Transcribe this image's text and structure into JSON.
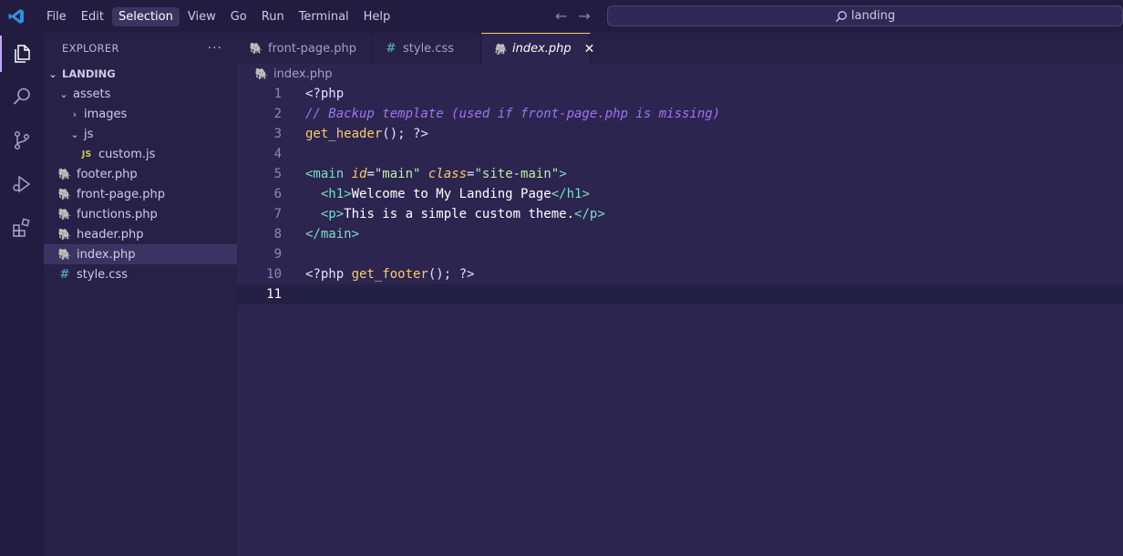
{
  "titlebar": {
    "menu": [
      "File",
      "Edit",
      "Selection",
      "View",
      "Go",
      "Run",
      "Terminal",
      "Help"
    ],
    "active_menu_index": 2,
    "search_text": "landing"
  },
  "sidebar": {
    "title": "EXPLORER",
    "more": "···",
    "root": "LANDING",
    "tree": [
      {
        "label": "assets",
        "depth": 1,
        "kind": "folder",
        "open": true
      },
      {
        "label": "images",
        "depth": 2,
        "kind": "folder",
        "open": false
      },
      {
        "label": "js",
        "depth": 2,
        "kind": "folder",
        "open": true
      },
      {
        "label": "custom.js",
        "depth": 3,
        "kind": "js"
      },
      {
        "label": "footer.php",
        "depth": 1,
        "kind": "php"
      },
      {
        "label": "front-page.php",
        "depth": 1,
        "kind": "php"
      },
      {
        "label": "functions.php",
        "depth": 1,
        "kind": "php"
      },
      {
        "label": "header.php",
        "depth": 1,
        "kind": "php"
      },
      {
        "label": "index.php",
        "depth": 1,
        "kind": "php",
        "selected": true
      },
      {
        "label": "style.css",
        "depth": 1,
        "kind": "css"
      }
    ]
  },
  "tabs": [
    {
      "label": "front-page.php",
      "kind": "php",
      "active": false
    },
    {
      "label": "style.css",
      "kind": "css",
      "active": false
    },
    {
      "label": "index.php",
      "kind": "php",
      "active": true
    }
  ],
  "breadcrumb": "index.php",
  "editor": {
    "current_line": 11,
    "lines": [
      [
        [
          "plain",
          "<?php"
        ]
      ],
      [
        [
          "comment",
          "// Backup template (used if front-page.php is missing)"
        ]
      ],
      [
        [
          "func",
          "get_header"
        ],
        [
          "plain",
          "(); ?>"
        ]
      ],
      [],
      [
        [
          "tag",
          "<main "
        ],
        [
          "attr",
          "id"
        ],
        [
          "plain",
          "="
        ],
        [
          "str",
          "\"main\""
        ],
        [
          "plain",
          " "
        ],
        [
          "attr",
          "class"
        ],
        [
          "plain",
          "="
        ],
        [
          "str",
          "\"site-main\""
        ],
        [
          "tag",
          ">"
        ]
      ],
      [
        [
          "plain",
          "  "
        ],
        [
          "tag",
          "<h1>"
        ],
        [
          "text",
          "Welcome to My Landing Page"
        ],
        [
          "tag",
          "</h1>"
        ]
      ],
      [
        [
          "plain",
          "  "
        ],
        [
          "tag",
          "<p>"
        ],
        [
          "text",
          "This is a simple custom theme."
        ],
        [
          "tag",
          "</p>"
        ]
      ],
      [
        [
          "tag",
          "</main>"
        ]
      ],
      [],
      [
        [
          "plain",
          "<?php "
        ],
        [
          "func",
          "get_footer"
        ],
        [
          "plain",
          "(); ?>"
        ]
      ],
      []
    ]
  }
}
